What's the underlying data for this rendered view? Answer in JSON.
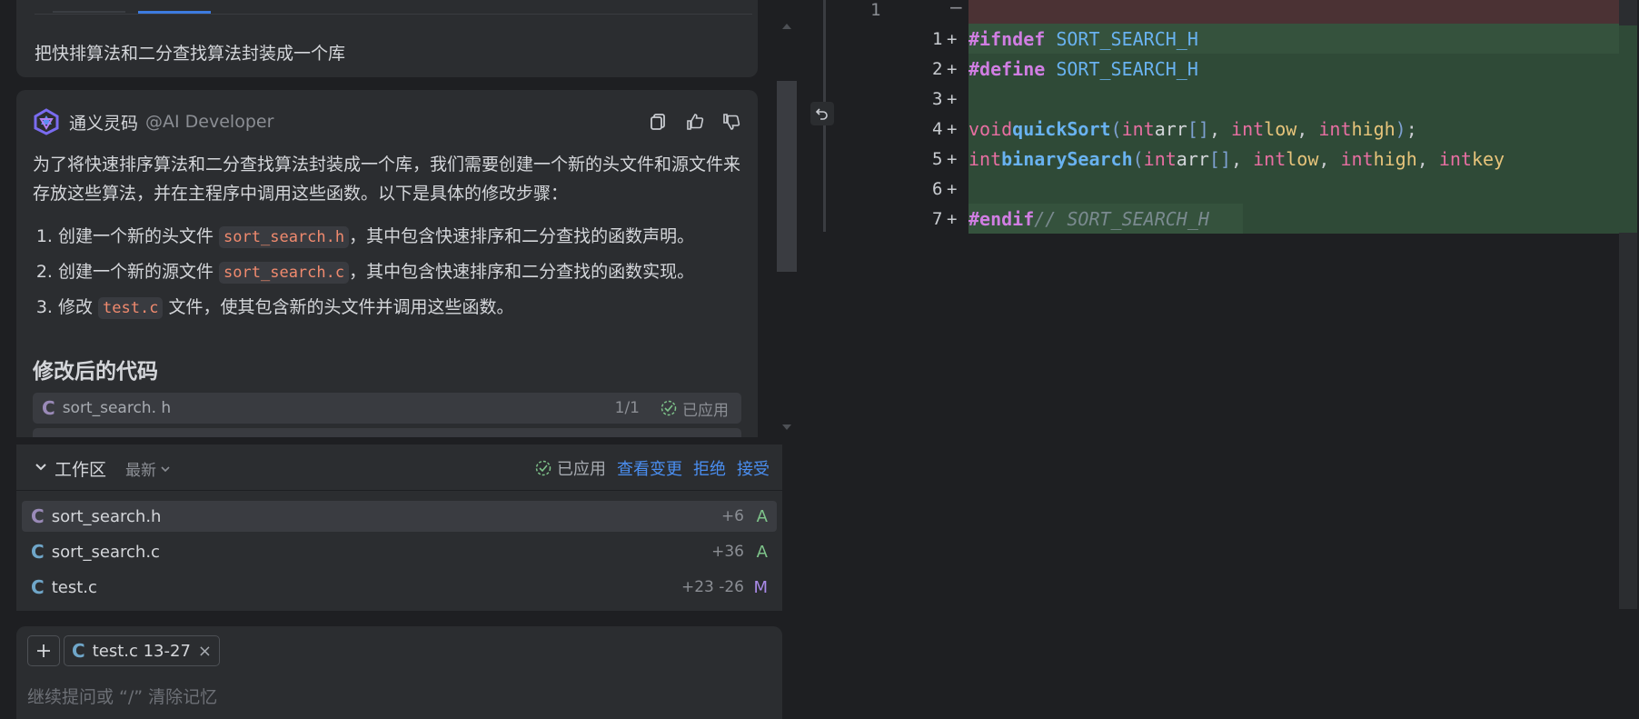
{
  "chat": {
    "user_message": "把快排算法和二分查找算法封装成一个库",
    "assistant": {
      "name": "通义灵码",
      "handle": "@AI Developer",
      "intro": "为了将快速排序算法和二分查找算法封装成一个库，我们需要创建一个新的头文件和源文件来存放这些算法，并在主程序中调用这些函数。以下是具体的修改步骤：",
      "steps": [
        {
          "pre": "创建一个新的头文件 ",
          "code": "sort_search.h",
          "post": "，其中包含快速排序和二分查找的函数声明。"
        },
        {
          "pre": "创建一个新的源文件 ",
          "code": "sort_search.c",
          "post": "，其中包含快速排序和二分查找的函数实现。"
        },
        {
          "pre": "修改 ",
          "code": "test.c",
          "post": " 文件，使其包含新的头文件并调用这些函数。"
        }
      ],
      "section_title": "修改后的代码",
      "files": [
        {
          "name": "sort_search. h",
          "ratio": "1/1",
          "status": "已应用"
        }
      ]
    }
  },
  "workspace": {
    "title": "工作区",
    "sort": "最新",
    "applied": "已应用",
    "view_changes": "查看变更",
    "reject": "拒绝",
    "accept": "接受",
    "files": [
      {
        "name": "sort_search.h",
        "delta": "+6",
        "state": "A"
      },
      {
        "name": "sort_search.c",
        "delta": "+36",
        "state": "A"
      },
      {
        "name": "test.c",
        "delta": "+23 -26",
        "state": "M"
      }
    ]
  },
  "input": {
    "context_chip": "test.c 13-27",
    "placeholder": "继续提问或 “/” 清除记忆"
  },
  "editor": {
    "left_line_number": "1",
    "line_numbers": [
      "1",
      "2",
      "3",
      "4",
      "5",
      "6",
      "7"
    ]
  },
  "colors": {
    "accent_link": "#4a8ef0",
    "added_bg": "#2f4a37",
    "removed_bg": "#4b3234"
  }
}
